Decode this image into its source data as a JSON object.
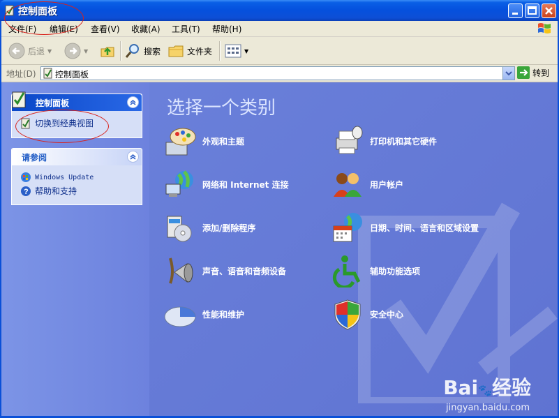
{
  "window": {
    "title": "控制面板"
  },
  "menu": [
    "文件(F)",
    "编辑(E)",
    "查看(V)",
    "收藏(A)",
    "工具(T)",
    "帮助(H)"
  ],
  "toolbar": {
    "back": "后退",
    "search": "搜索",
    "folders": "文件夹"
  },
  "address": {
    "label": "地址(D)",
    "value": "控制面板",
    "go": "转到"
  },
  "sidebar": {
    "panel1": {
      "title": "控制面板",
      "link": "切换到经典视图"
    },
    "panel2": {
      "title": "请参阅",
      "links": [
        "Windows Update",
        "帮助和支持"
      ]
    }
  },
  "main": {
    "heading": "选择一个类别",
    "categories": [
      {
        "label": "外观和主题",
        "icon": "appearance-icon"
      },
      {
        "label": "打印机和其它硬件",
        "icon": "printer-icon"
      },
      {
        "label": "网络和 Internet 连接",
        "icon": "network-icon"
      },
      {
        "label": "用户帐户",
        "icon": "users-icon"
      },
      {
        "label": "添加/删除程序",
        "icon": "add-remove-programs-icon"
      },
      {
        "label": "日期、时间、语言和区域设置",
        "icon": "date-time-icon"
      },
      {
        "label": "声音、语音和音频设备",
        "icon": "sound-icon"
      },
      {
        "label": "辅助功能选项",
        "icon": "accessibility-icon"
      },
      {
        "label": "性能和维护",
        "icon": "performance-icon"
      },
      {
        "label": "安全中心",
        "icon": "security-center-icon"
      }
    ]
  },
  "watermark": {
    "brand": "Bai",
    "brand2": "经验",
    "url": "jingyan.baidu.com"
  },
  "colors": {
    "titlebar": "#0551de",
    "content_bg": "#6b7fd9",
    "annotation": "#d8201a"
  }
}
